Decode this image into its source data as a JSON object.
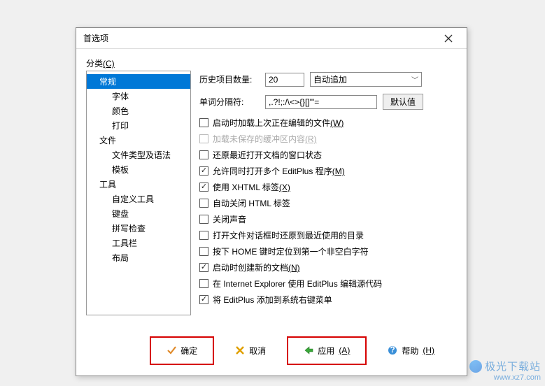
{
  "dialog": {
    "title": "首选项"
  },
  "category_label": {
    "text": "分类",
    "accel": "(C)"
  },
  "tree": [
    {
      "label": "常规",
      "level": 1,
      "selected": true
    },
    {
      "label": "字体",
      "level": 2
    },
    {
      "label": "颜色",
      "level": 2
    },
    {
      "label": "打印",
      "level": 2
    },
    {
      "label": "文件",
      "level": 1
    },
    {
      "label": "文件类型及语法",
      "level": 2
    },
    {
      "label": "模板",
      "level": 2
    },
    {
      "label": "工具",
      "level": 1
    },
    {
      "label": "自定义工具",
      "level": 2
    },
    {
      "label": "键盘",
      "level": 2
    },
    {
      "label": "拼写检查",
      "level": 2
    },
    {
      "label": "工具栏",
      "level": 2
    },
    {
      "label": "布局",
      "level": 2
    }
  ],
  "fields": {
    "history_label": "历史项目数量:",
    "history_value": "20",
    "history_mode": "自动追加",
    "wordsep_label": "单词分隔符:",
    "wordsep_value": ",.?!;:/\\<>{}[]\"'=",
    "default_btn": "默认值"
  },
  "checks": [
    {
      "label": "启动时加载上次正在编辑的文件",
      "accel": "(W)",
      "checked": false,
      "disabled": false
    },
    {
      "label": "加载未保存的缓冲区内容",
      "accel": "(R)",
      "checked": false,
      "disabled": true
    },
    {
      "label": "还原最近打开文档的窗口状态",
      "accel": "",
      "checked": false,
      "disabled": false
    },
    {
      "label": "允许同时打开多个 EditPlus 程序",
      "accel": "(M)",
      "checked": true,
      "disabled": false
    },
    {
      "label": "使用 XHTML 标签",
      "accel": "(X)",
      "checked": true,
      "disabled": false
    },
    {
      "label": "自动关闭 HTML 标签",
      "accel": "",
      "checked": false,
      "disabled": false
    },
    {
      "label": "关闭声音",
      "accel": "",
      "checked": false,
      "disabled": false
    },
    {
      "label": "打开文件对话框时还原到最近使用的目录",
      "accel": "",
      "checked": false,
      "disabled": false
    },
    {
      "label": "按下 HOME 键时定位到第一个非空白字符",
      "accel": "",
      "checked": false,
      "disabled": false
    },
    {
      "label": "启动时创建新的文档",
      "accel": "(N)",
      "checked": true,
      "disabled": false
    },
    {
      "label": "在 Internet Explorer 使用 EditPlus 编辑源代码",
      "accel": "",
      "checked": false,
      "disabled": false
    },
    {
      "label": "将 EditPlus 添加到系统右键菜单",
      "accel": "",
      "checked": true,
      "disabled": false
    }
  ],
  "footer": {
    "ok": "确定",
    "cancel": "取消",
    "apply": "应用",
    "apply_accel": "(A)",
    "help": "帮助",
    "help_accel": "(H)"
  },
  "watermark": {
    "brand": "极光下载站",
    "url": "www.xz7.com"
  }
}
